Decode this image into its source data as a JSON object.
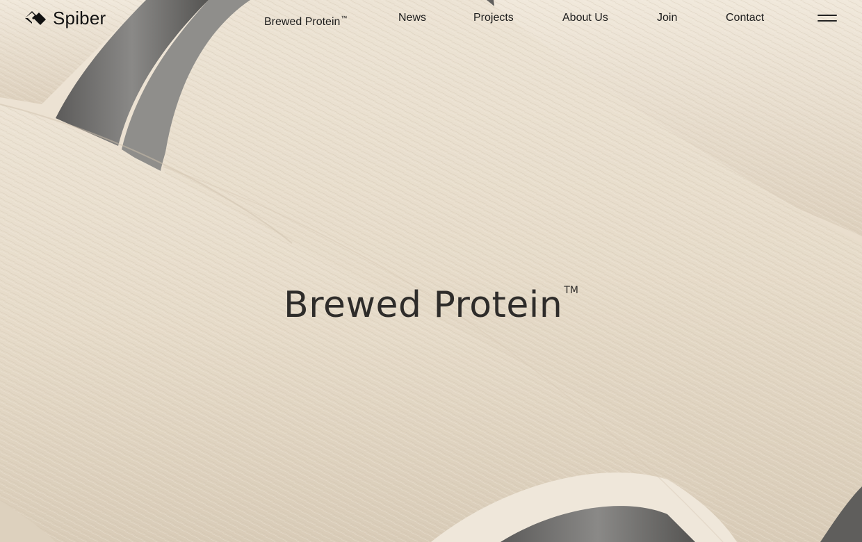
{
  "brand": {
    "name": "Spiber"
  },
  "nav": {
    "items": [
      {
        "label": "Brewed Protein",
        "tm": "™"
      },
      {
        "label": "News"
      },
      {
        "label": "Projects"
      },
      {
        "label": "About Us"
      },
      {
        "label": "Join"
      },
      {
        "label": "Contact"
      }
    ]
  },
  "hero": {
    "title": "Brewed Protein",
    "title_tm": "TM"
  },
  "colors": {
    "thread": "#eae0d0",
    "spool_core": "#6f6e6c",
    "text": "#2e2c2a"
  },
  "icons": {
    "logo": "spiber-diamond-logo-icon",
    "menu": "hamburger-menu-icon"
  }
}
